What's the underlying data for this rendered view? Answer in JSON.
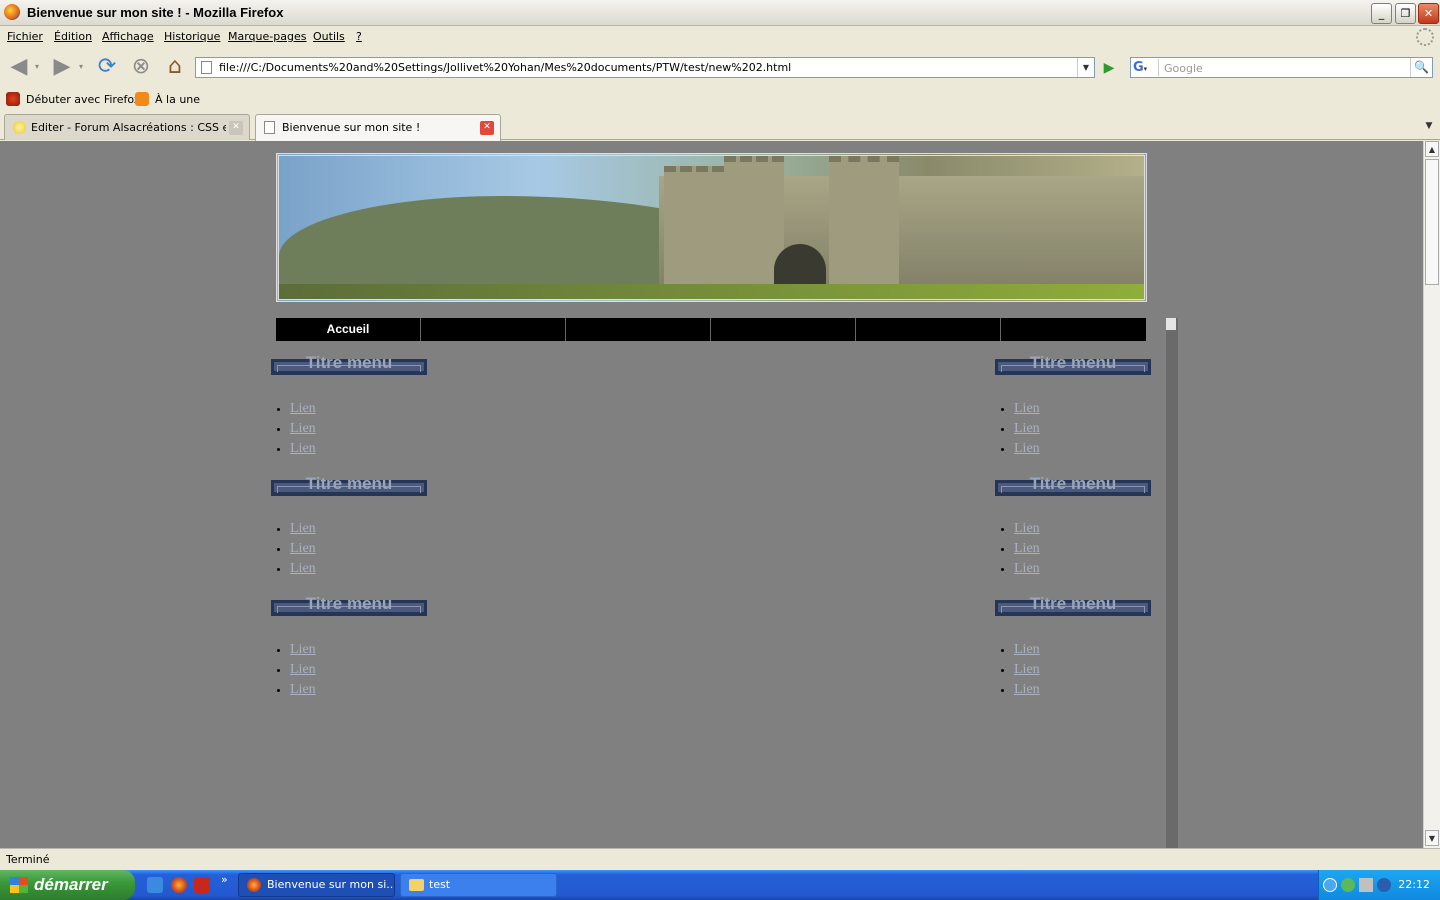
{
  "window": {
    "title": "Bienvenue sur mon site ! - Mozilla Firefox"
  },
  "menubar": {
    "items": [
      "Fichier",
      "Édition",
      "Affichage",
      "Historique",
      "Marque-pages",
      "Outils",
      "?"
    ]
  },
  "navbar": {
    "url": "file:///C:/Documents%20and%20Settings/Jollivet%20Yohan/Mes%20documents/PTW/test/new%202.html",
    "search_placeholder": "Google",
    "search_engine": "G"
  },
  "bookmarks": [
    "Débuter avec Firefox",
    "À la une"
  ],
  "tabs": [
    {
      "label": "Editer - Forum Alsacréations : CSS et ...",
      "active": false
    },
    {
      "label": "Bienvenue sur mon site !",
      "active": true
    }
  ],
  "page": {
    "nav": [
      "Accueil",
      "",
      "",
      "",
      "",
      ""
    ],
    "left_menus": [
      {
        "title": "Titre menu",
        "links": [
          "Lien",
          "Lien",
          "Lien"
        ]
      },
      {
        "title": "Titre menu",
        "links": [
          "Lien",
          "Lien",
          "Lien"
        ]
      },
      {
        "title": "Titre menu",
        "links": [
          "Lien",
          "Lien",
          "Lien"
        ]
      }
    ],
    "right_menus": [
      {
        "title": "Titre menu",
        "links": [
          "Lien",
          "Lien",
          "Lien"
        ]
      },
      {
        "title": "Titre menu",
        "links": [
          "Lien",
          "Lien",
          "Lien"
        ]
      },
      {
        "title": "Titre menu",
        "links": [
          "Lien",
          "Lien",
          "Lien"
        ]
      }
    ]
  },
  "status": {
    "text": "Terminé"
  },
  "taskbar": {
    "start_label": "démarrer",
    "tasks": [
      "Bienvenue sur mon si...",
      "test"
    ],
    "clock": "22:12",
    "more_glyph": "»"
  },
  "colors": {
    "page_bg": "#808080",
    "menu_title_bg": "#4a5a7e",
    "link": "#aab0c0"
  }
}
